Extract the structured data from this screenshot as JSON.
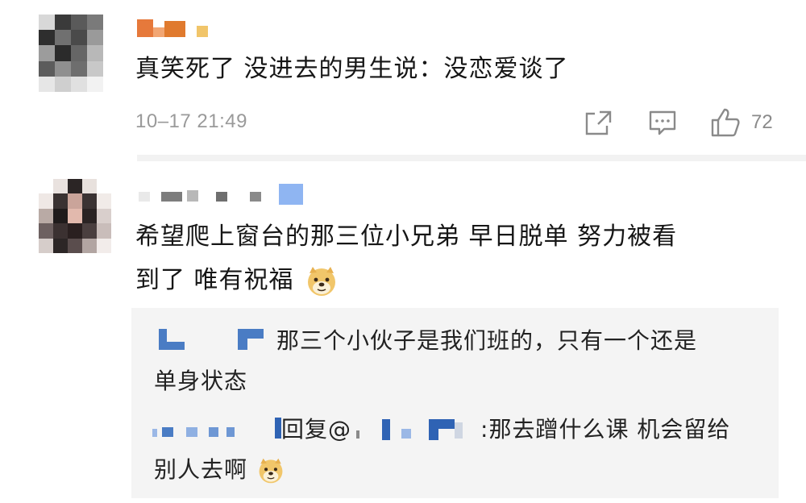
{
  "comments": [
    {
      "text": "真笑死了 没进去的男生说：没恋爱谈了",
      "time": "10–17 21:49",
      "likes": "72",
      "icons": [
        "share-icon",
        "comment-icon",
        "like-icon"
      ]
    },
    {
      "text_line1": "希望爬上窗台的那三位小兄弟 早日脱单 努力被看",
      "text_line2": "到了 唯有祝福",
      "emoji": "doge-emoji",
      "replies": [
        {
          "text_line1": "那三个小伙子是我们班的，只有一个还是",
          "text_line2": "单身状态"
        },
        {
          "reply_word": "回复",
          "at": "@",
          "text_line1": ":那去蹭什么课 机会留给",
          "text_line2": "别人去啊",
          "emoji": "doge-emoji"
        }
      ]
    }
  ],
  "colors": {
    "divider": "#f2f2f2",
    "reply_bg": "#f4f4f4",
    "meta_text": "#9a9a9a",
    "name_blue": "#4a7cc4",
    "name_orange": "#e07a2e"
  }
}
